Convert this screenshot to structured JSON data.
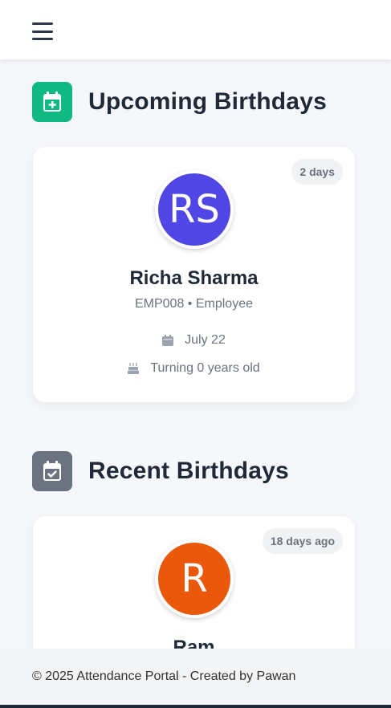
{
  "header": {
    "menu_icon": "hamburger-menu-icon"
  },
  "upcoming": {
    "title": "Upcoming Birthdays",
    "icon": "calendar-plus-icon",
    "icon_color": "#10b981",
    "card": {
      "badge": "2 days",
      "initials": "RS",
      "avatar_color": "#4f46e5",
      "name": "Richa Sharma",
      "meta": "EMP008 • Employee",
      "date": "July 22",
      "date_icon": "calendar-icon",
      "age": "Turning 0 years old",
      "age_icon": "birthday-cake-icon"
    }
  },
  "recent": {
    "title": "Recent Birthdays",
    "icon": "calendar-check-icon",
    "icon_color": "#6b7280",
    "card": {
      "badge": "18 days ago",
      "initials": "R",
      "avatar_color": "#ea580c",
      "name": "Ram"
    }
  },
  "footer": {
    "text": "© 2025 Attendance Portal - Created by Pawan"
  }
}
